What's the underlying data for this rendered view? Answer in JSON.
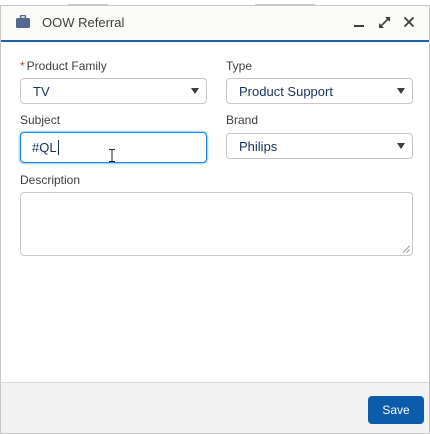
{
  "header": {
    "title": "OOW Referral",
    "icon": "briefcase-icon",
    "controls": [
      "minimize-icon",
      "expand-icon",
      "close-icon"
    ]
  },
  "form": {
    "product_family": {
      "label": "Product Family",
      "required_mark": "*",
      "value": "TV"
    },
    "type": {
      "label": "Type",
      "value": "Product Support"
    },
    "subject": {
      "label": "Subject",
      "value": "#QL"
    },
    "brand": {
      "label": "Brand",
      "value": "Philips"
    },
    "description": {
      "label": "Description",
      "value": ""
    }
  },
  "footer": {
    "save_label": "Save"
  },
  "colors": {
    "accent": "#1b5fae",
    "button": "#0b5cab",
    "focus": "#1589ee",
    "required": "#c23934"
  }
}
